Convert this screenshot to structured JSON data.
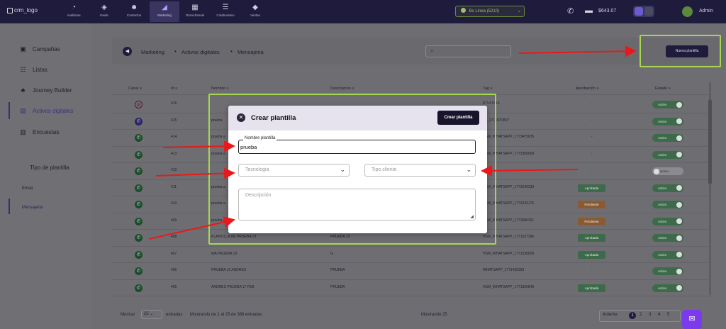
{
  "brand": {
    "logo_text": "crm_logo"
  },
  "nav": {
    "tabs": [
      {
        "label": "Analiticas",
        "icon": "chart-pie-icon"
      },
      {
        "label": "Deals",
        "icon": "layers-icon"
      },
      {
        "label": "Contactos",
        "icon": "users-icon"
      },
      {
        "label": "Marketing",
        "icon": "megaphone-icon"
      },
      {
        "label": "Omnichannel",
        "icon": "grid-icon"
      },
      {
        "label": "Colaborativo",
        "icon": "list-icon"
      },
      {
        "label": "Ventas",
        "icon": "tag-icon"
      }
    ],
    "line_select": "Bs Linea (5210)",
    "balance": "$643.07",
    "username": "Admin"
  },
  "sidebar": {
    "items": [
      {
        "label": "Campañas",
        "icon": "campaign-icon"
      },
      {
        "label": "Listas",
        "icon": "list-icon"
      },
      {
        "label": "Journey Builder",
        "icon": "journey-icon"
      },
      {
        "label": "Activos digitales",
        "icon": "assets-icon"
      },
      {
        "label": "Encuestas",
        "icon": "survey-icon"
      }
    ],
    "tipo_title": "Tipo de plantilla",
    "sub_items": [
      "Email",
      "Mensajeria"
    ]
  },
  "breadcrumb": {
    "items": [
      "Marketing",
      "Activos digitales",
      "Mensajeria"
    ]
  },
  "actions": {
    "new_template": "Nueva plantilla"
  },
  "table": {
    "headers": {
      "canal": "Canal",
      "id": "Id",
      "nombre": "Nombre",
      "descripcion": "Descripción",
      "tag": "Tag",
      "aprobacion": "Aprobación",
      "estado": "Estado"
    },
    "rows": [
      {
        "id": "416",
        "nombre": "",
        "descripcion": "",
        "tag": "8714 5316",
        "aprobacion": "-",
        "estado": "Activo"
      },
      {
        "id": "415",
        "nombre": "prueba",
        "descripcion": "",
        "tag": "FL_171497D807",
        "aprobacion": "-",
        "estado": "Activo"
      },
      {
        "id": "414",
        "nombre": "prueba a",
        "descripcion": "",
        "tag": "HSM_WHATSAPP_1773475635",
        "aprobacion": "-",
        "estado": "Activo"
      },
      {
        "id": "413",
        "nombre": "prueba a",
        "descripcion": "",
        "tag": "HSM_WHATSAPP_1773350909",
        "aprobacion": "-",
        "estado": "Activo"
      },
      {
        "id": "412",
        "nombre": "",
        "descripcion": "",
        "tag": "",
        "aprobacion": "-",
        "estado": "Inactivo"
      },
      {
        "id": "411",
        "nombre": "prueba a",
        "descripcion": "",
        "tag": "HSM_WHATSAPP_1773245333",
        "aprobacion": "Aprobada",
        "estado": "Activo"
      },
      {
        "id": "410",
        "nombre": "prueba a",
        "descripcion": "",
        "tag": "HSM_WHATSAPP_1773243176",
        "aprobacion": "Pendiente",
        "estado": "Activo"
      },
      {
        "id": "409",
        "nombre": "prueba a",
        "descripcion": "",
        "tag": "HSM_WHATSAPP_1773086301",
        "aprobacion": "Pendiente",
        "estado": "Activo"
      },
      {
        "id": "408",
        "nombre": "PLANTILLA DE PRUEBA 19",
        "descripcion": "PRUEBA 19",
        "tag": "HSM_WHATSAPP_1771537396",
        "aprobacion": "Aprobada",
        "estado": "Activo"
      },
      {
        "id": "407",
        "nombre": "WA PRUEBA 19",
        "descripcion": "G",
        "tag": "HSM_WHATSAPP_1771536828",
        "aprobacion": "Aprobada",
        "estado": "Activo"
      },
      {
        "id": "406",
        "nombre": "PRUEBA 10 ANDRES",
        "descripcion": "PRUEBA",
        "tag": "WHATSAPP_1771435393",
        "aprobacion": "-",
        "estado": "Activo"
      },
      {
        "id": "405",
        "nombre": "ANDRES PRUEBA 17 FEB",
        "descripcion": "PRUEBA",
        "tag": "HSM_WHATSAPP_1771360843",
        "aprobacion": "Aprobada",
        "estado": "Activo"
      }
    ]
  },
  "footer": {
    "mostrar": "Mostrar",
    "page_size": "25",
    "entradas": "entradas",
    "showing": "Mostrando de 1 al 25 de 366 entradas",
    "selected": "Mostrando 25",
    "anterior": "Anterior",
    "pages": [
      "1",
      "2",
      "3",
      "4",
      "5"
    ]
  },
  "modal": {
    "title": "Crear plantilla",
    "create_button": "Crear plantilla",
    "name_label": "Nombre plantilla",
    "name_value": "prueba",
    "tecnologia_placeholder": "Tecnologia",
    "tipo_cliente_placeholder": "Tipo cliente",
    "descripcion_placeholder": "Descripción"
  },
  "colors": {
    "accent": "#7c3aed",
    "highlight": "#a6d650",
    "arrow": "#e8191b",
    "navy": "#1e1b3d"
  }
}
